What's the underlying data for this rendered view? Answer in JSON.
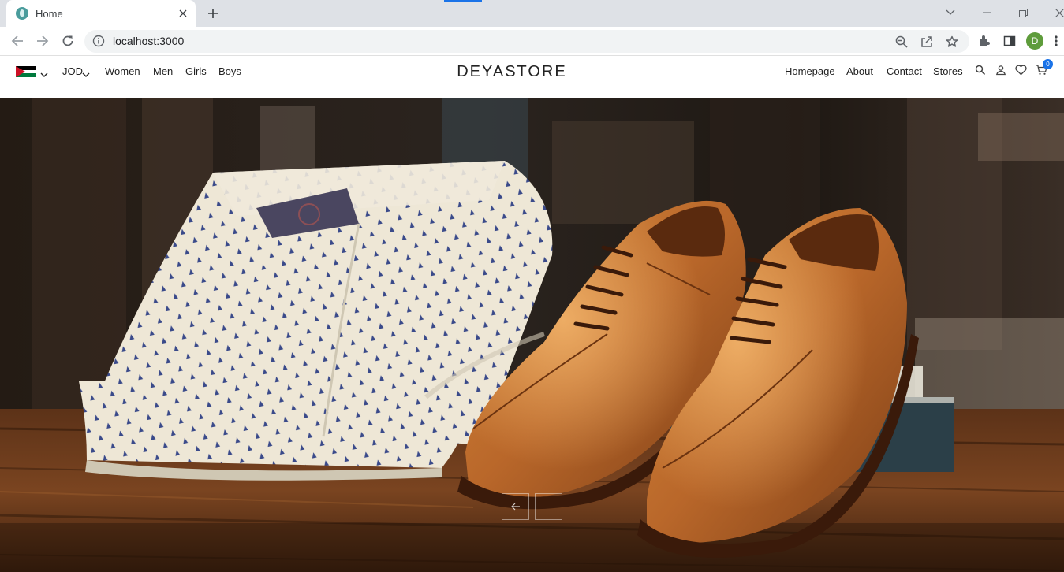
{
  "browser": {
    "tab_title": "Home",
    "url": "localhost:3000",
    "profile_initial": "D"
  },
  "header": {
    "currency": "JOD",
    "left_nav": [
      "Women",
      "Men",
      "Girls",
      "Boys"
    ],
    "brand": "DEYASTORE",
    "right_nav": [
      "Homepage",
      "About",
      "Contact",
      "Stores"
    ],
    "cart_count": "0"
  },
  "hero": {
    "image_description": "folded-shirts-and-leather-shoes"
  },
  "colors": {
    "accent": "#1a73e8",
    "brand_text": "#222222"
  }
}
